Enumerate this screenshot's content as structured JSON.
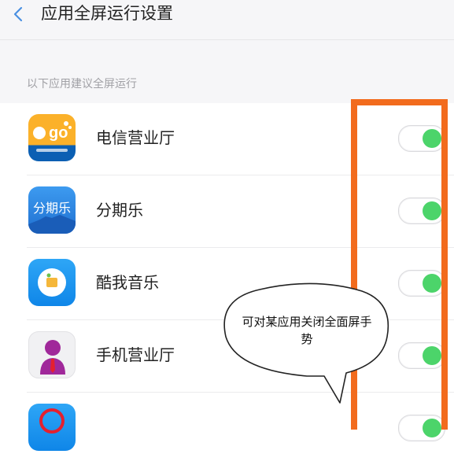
{
  "header": {
    "title": "应用全屏运行设置"
  },
  "section": {
    "label": "以下应用建议全屏运行"
  },
  "apps": [
    {
      "name": "电信营业厅",
      "enabled": true,
      "icon": "telecom-ego-icon"
    },
    {
      "name": "分期乐",
      "enabled": true,
      "icon": "fenqile-icon",
      "icon_text": "分期乐"
    },
    {
      "name": "酷我音乐",
      "enabled": true,
      "icon": "kuwo-music-icon"
    },
    {
      "name": "手机营业厅",
      "enabled": true,
      "icon": "mobile-hall-icon"
    }
  ],
  "callout": {
    "text": "可对某应用关闭全面屏手势"
  },
  "colors": {
    "toggle_on": "#4cd46a",
    "highlight": "#f26b1d"
  }
}
